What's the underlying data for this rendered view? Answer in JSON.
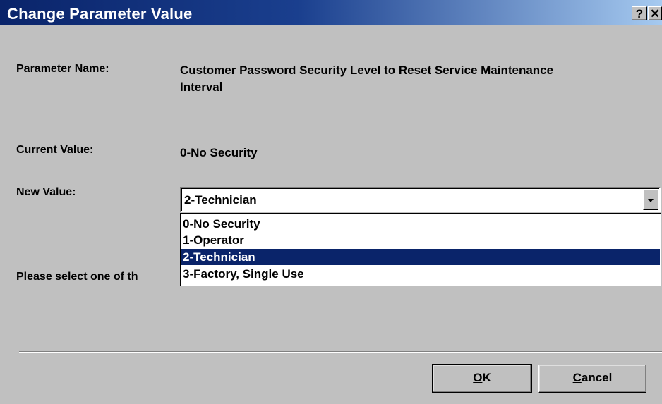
{
  "window": {
    "title": "Change Parameter Value",
    "help_label": "?",
    "close_label": "✕"
  },
  "parameter": {
    "name_label": "Parameter Name:",
    "name_value_line1": "Customer Password Security Level to Reset Service Maintenance",
    "name_value_line2": "Interval"
  },
  "current": {
    "label": "Current Value:",
    "value": "0-No Security"
  },
  "new_value": {
    "label": "New Value:",
    "selected": "2-Technician",
    "options": [
      "0-No Security",
      "1-Operator",
      "2-Technician",
      "3-Factory, Single Use"
    ],
    "highlighted_index": 2
  },
  "instruction": "Please select one of th",
  "buttons": {
    "ok_mnemonic": "O",
    "ok_rest": "K",
    "cancel_mnemonic": "C",
    "cancel_rest": "ancel"
  },
  "colors": {
    "title_bar": "#0a246a",
    "dialog_bg": "#c0c0c0",
    "selection": "#0a246a"
  }
}
